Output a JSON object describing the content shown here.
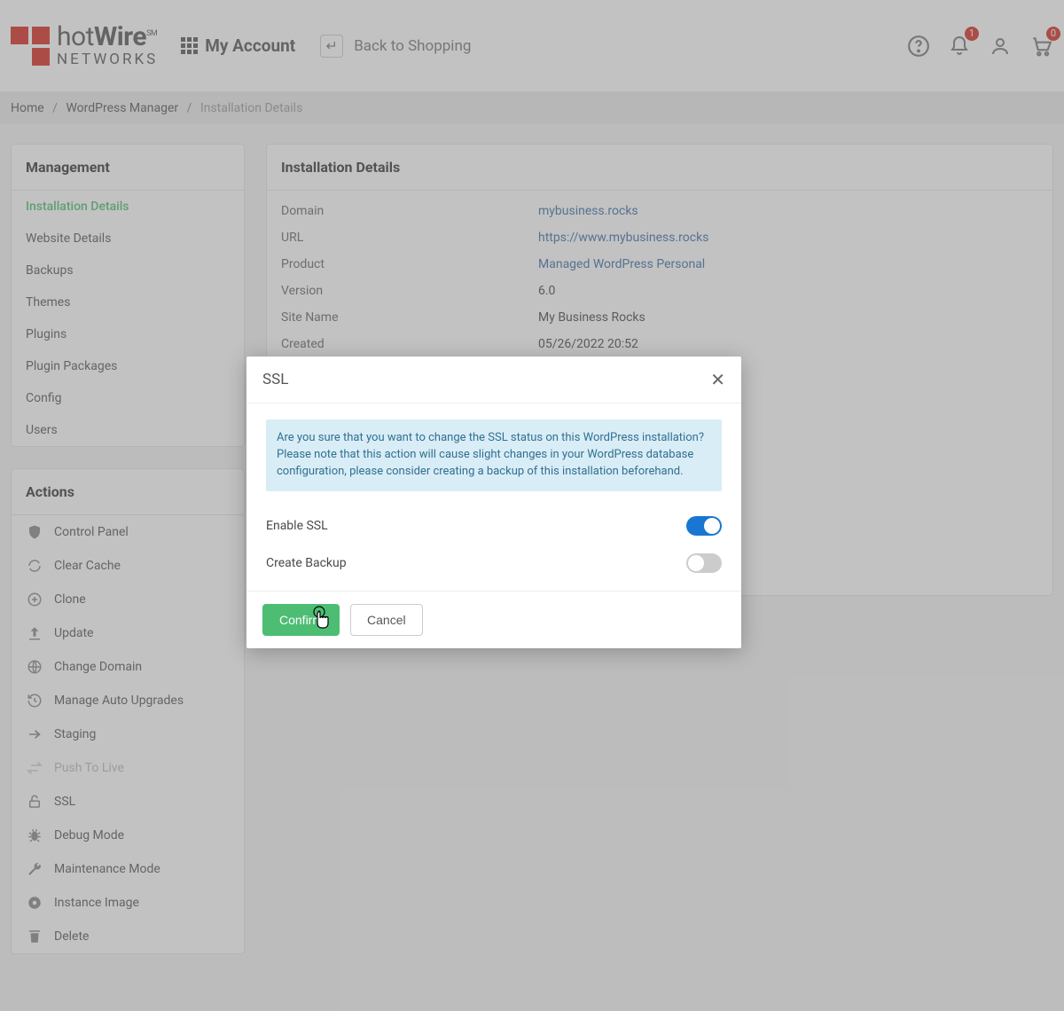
{
  "header": {
    "logo_line1_light": "hot",
    "logo_line1_bold": "Wire",
    "logo_sm": "SM",
    "logo_line2": "NETWORKS",
    "my_account": "My Account",
    "back_to_shopping": "Back to Shopping",
    "notif_count": "1",
    "cart_count": "0"
  },
  "breadcrumb": {
    "home": "Home",
    "wp": "WordPress Manager",
    "current": "Installation Details"
  },
  "sidebar": {
    "management_title": "Management",
    "items": [
      {
        "label": "Installation Details"
      },
      {
        "label": "Website Details"
      },
      {
        "label": "Backups"
      },
      {
        "label": "Themes"
      },
      {
        "label": "Plugins"
      },
      {
        "label": "Plugin Packages"
      },
      {
        "label": "Config"
      },
      {
        "label": "Users"
      }
    ],
    "actions_title": "Actions",
    "actions": [
      {
        "label": "Control Panel"
      },
      {
        "label": "Clear Cache"
      },
      {
        "label": "Clone"
      },
      {
        "label": "Update"
      },
      {
        "label": "Change Domain"
      },
      {
        "label": "Manage Auto Upgrades"
      },
      {
        "label": "Staging"
      },
      {
        "label": "Push To Live"
      },
      {
        "label": "SSL"
      },
      {
        "label": "Debug Mode"
      },
      {
        "label": "Maintenance Mode"
      },
      {
        "label": "Instance Image"
      },
      {
        "label": "Delete"
      }
    ]
  },
  "main": {
    "title": "Installation Details",
    "rows": {
      "domain_k": "Domain",
      "domain_v": "mybusiness.rocks",
      "url_k": "URL",
      "url_v": "https://www.mybusiness.rocks",
      "product_k": "Product",
      "product_v": "Managed WordPress Personal",
      "version_k": "Version",
      "version_v": "6.0",
      "sitename_k": "Site Name",
      "sitename_v": "My Business Rocks",
      "created_k": "Created",
      "created_v": "05/26/2022 20:52"
    }
  },
  "modal": {
    "title": "SSL",
    "info": "Are you sure that you want to change the SSL status on this WordPress installation? Please note that this action will cause slight changes in your WordPress database configuration, please consider creating a backup of this installation beforehand.",
    "enable_ssl": "Enable SSL",
    "create_backup": "Create Backup",
    "confirm": "Confirm",
    "cancel": "Cancel"
  }
}
